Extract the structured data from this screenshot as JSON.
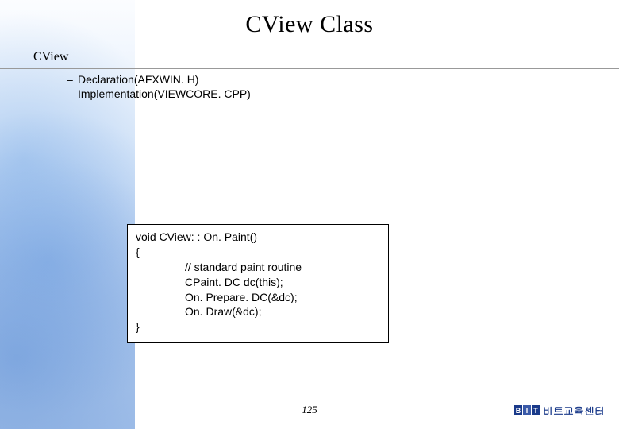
{
  "title": "CView Class",
  "subtitle": "CView",
  "bullets": [
    "Declaration(AFXWIN. H)",
    "Implementation(VIEWCORE. CPP)"
  ],
  "bullet_dash": "–",
  "code": {
    "line1": "void CView: : On. Paint()",
    "line2": "{",
    "line3": "// standard paint routine",
    "line4": "CPaint. DC dc(this);",
    "line5": "On. Prepare. DC(&dc);",
    "line6": "On. Draw(&dc);",
    "line7": "}"
  },
  "page_number": "125",
  "brand": {
    "letters": [
      "B",
      "I",
      "T"
    ],
    "text": "비트교육센터"
  }
}
